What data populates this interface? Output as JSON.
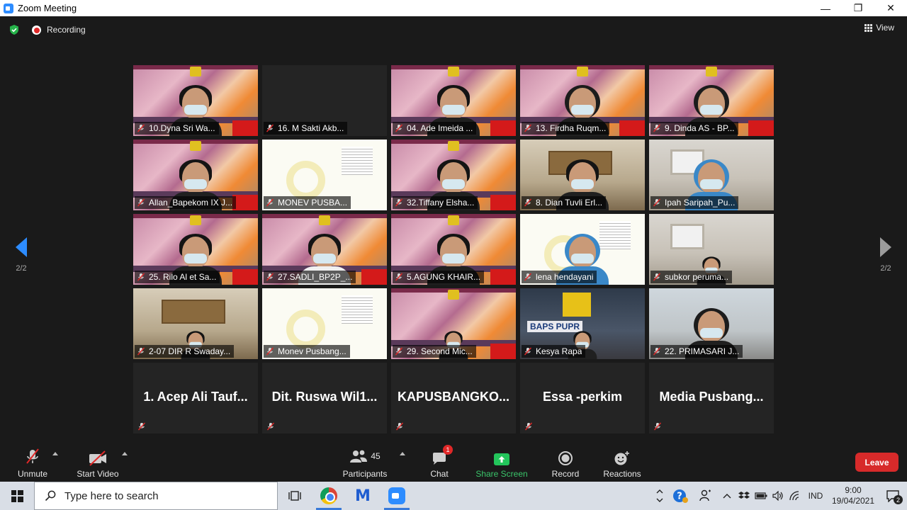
{
  "window": {
    "title": "Zoom Meeting",
    "minimize": "—",
    "restore": "❐",
    "close": "✕"
  },
  "topbar": {
    "recording_label": "Recording",
    "view_label": "View"
  },
  "pager": {
    "left": "2/2",
    "right": "2/2"
  },
  "tiles": [
    {
      "name": "10.Dyna Sri Wa...",
      "bg": "banner",
      "person": ""
    },
    {
      "name": "16. M Sakti Akb...",
      "bg": "dark",
      "person": "none"
    },
    {
      "name": "04. Ade Imeida ...",
      "bg": "banner",
      "person": ""
    },
    {
      "name": "13. Firdha Ruqm...",
      "bg": "banner",
      "person": "hijab"
    },
    {
      "name": "9. Dinda AS - BP...",
      "bg": "banner",
      "person": "hijab"
    },
    {
      "name": "Allan_Bapekom IX J...",
      "bg": "banner",
      "person": "",
      "active": true
    },
    {
      "name": "MONEV PUSBA...",
      "bg": "slide",
      "person": "none"
    },
    {
      "name": "32.Tiffany Elsha...",
      "bg": "banner",
      "person": ""
    },
    {
      "name": "8. Dian Tuvli Erl...",
      "bg": "office",
      "person": ""
    },
    {
      "name": "Ipah Saripah_Pu...",
      "bg": "room",
      "person": "hijab-blue"
    },
    {
      "name": "25. Rilo Al et Sa...",
      "bg": "banner",
      "person": ""
    },
    {
      "name": "27.SADLI_BP2P_...",
      "bg": "banner",
      "person": "white"
    },
    {
      "name": "5.AGUNG KHAIR...",
      "bg": "banner",
      "person": ""
    },
    {
      "name": "lena hendayani",
      "bg": "slide",
      "person": "hijab-blue"
    },
    {
      "name": "subkor peruma...",
      "bg": "room",
      "person": "small"
    },
    {
      "name": "2-07 DIR R Swaday...",
      "bg": "office",
      "person": "small"
    },
    {
      "name": "Monev Pusbang...",
      "bg": "slide",
      "person": "none"
    },
    {
      "name": "29. Second Mic...",
      "bg": "banner",
      "person": "small"
    },
    {
      "name": "Kesya Rapa",
      "bg": "bapp",
      "person": "small",
      "bap_text": "BAPS PUPR"
    },
    {
      "name": "22. PRIMASARI J...",
      "bg": "plain",
      "person": "hijab"
    }
  ],
  "no_video_tiles": [
    {
      "name": "1. Acep Ali Tauf..."
    },
    {
      "name": "Dit. Ruswa Wil1..."
    },
    {
      "name": "KAPUSBANGKO..."
    },
    {
      "name": "Essa -perkim"
    },
    {
      "name": "Media Pusbang..."
    }
  ],
  "toolbar": {
    "unmute": "Unmute",
    "start_video": "Start Video",
    "participants": "Participants",
    "participants_count": "45",
    "chat": "Chat",
    "chat_badge": "1",
    "share_screen": "Share Screen",
    "record": "Record",
    "reactions": "Reactions",
    "leave": "Leave"
  },
  "taskbar": {
    "search_placeholder": "Type here to search",
    "language": "IND",
    "time": "9:00",
    "date": "19/04/2021",
    "notifications": "2"
  },
  "colors": {
    "accent": "#2d8cff",
    "leave": "#d72a2a",
    "share": "#3ac56a",
    "active_speaker": "#d8f03c"
  }
}
